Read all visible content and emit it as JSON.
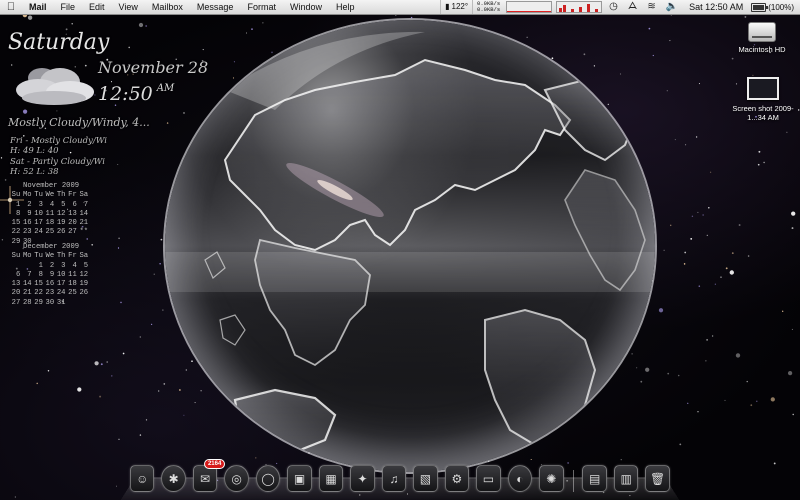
{
  "menubar": {
    "apple_icon": "apple-icon",
    "items": [
      "Mail",
      "File",
      "Edit",
      "View",
      "Mailbox",
      "Message",
      "Format",
      "Window",
      "Help"
    ],
    "temperature": "122°",
    "net_up": "0.0KB/s",
    "net_down": "0.0KB/s",
    "status_icons": [
      "time-machine-icon",
      "bluetooth-icon",
      "wifi-icon",
      "volume-icon"
    ],
    "clock": "Sat 12:50 AM",
    "battery": "(100%)",
    "battery_level": 1.0
  },
  "weather": {
    "day": "Saturday",
    "date": "November 28",
    "time": "12:50",
    "ampm": "AM",
    "condition": "Mostly Cloudy/Windy, 4...",
    "forecast": [
      {
        "line1": "Fri - Mostly Cloudy/Wi",
        "line2": "H: 49  L: 40"
      },
      {
        "line1": "Sat - Partly Cloudy/Wi",
        "line2": "H: 52  L: 38"
      }
    ],
    "icon": "cloud-icon"
  },
  "calendars": [
    {
      "title": "November 2009",
      "days": [
        "Su",
        "Mo",
        "Tu",
        "We",
        "Th",
        "Fr",
        "Sa"
      ],
      "weeks": [
        [
          "1",
          "2",
          "3",
          "4",
          "5",
          "6",
          "7"
        ],
        [
          "8",
          "9",
          "10",
          "11",
          "12",
          "13",
          "14"
        ],
        [
          "15",
          "16",
          "17",
          "18",
          "19",
          "20",
          "21"
        ],
        [
          "22",
          "23",
          "24",
          "25",
          "26",
          "27",
          "**"
        ],
        [
          "29",
          "30",
          "",
          "",
          "",
          "",
          ""
        ]
      ]
    },
    {
      "title": "December 2009",
      "days": [
        "Su",
        "Mo",
        "Tu",
        "We",
        "Th",
        "Fr",
        "Sa"
      ],
      "weeks": [
        [
          "",
          "",
          "1",
          "2",
          "3",
          "4",
          "5"
        ],
        [
          "6",
          "7",
          "8",
          "9",
          "10",
          "11",
          "12"
        ],
        [
          "13",
          "14",
          "15",
          "16",
          "17",
          "18",
          "19"
        ],
        [
          "20",
          "21",
          "22",
          "23",
          "24",
          "25",
          "26"
        ],
        [
          "27",
          "28",
          "29",
          "30",
          "31",
          "",
          ""
        ]
      ]
    }
  ],
  "desktop_icons": [
    {
      "label": "Macintosh HD",
      "icon": "hard-drive-icon"
    },
    {
      "label": "Screen shot 2009-1...34 AM",
      "icon": "screenshot-file-icon"
    }
  ],
  "dock": {
    "mail_badge": "2164",
    "items": [
      "finder-icon",
      "app-icon",
      "mail-icon",
      "safari-icon",
      "ichat-icon",
      "address-book-icon",
      "ical-icon",
      "preview-icon",
      "itunes-icon",
      "iphoto-icon",
      "system-preferences-icon",
      "terminal-icon",
      "time-machine-icon",
      "photo-icon",
      "downloads-folder-icon",
      "documents-folder-icon",
      "trash-icon"
    ]
  }
}
